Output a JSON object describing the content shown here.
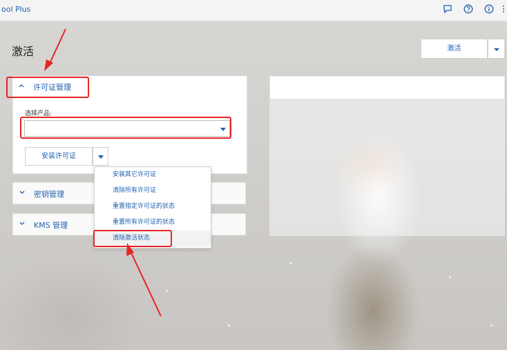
{
  "app": {
    "title": "ool Plus"
  },
  "topbar": {
    "icons": [
      "feedback-icon",
      "help-icon",
      "info-icon",
      "more-icon"
    ]
  },
  "page": {
    "title": "激活"
  },
  "activate_button": {
    "label": "激活"
  },
  "sections": [
    {
      "label": "许可证管理",
      "expanded": true
    },
    {
      "label": "密钥管理",
      "expanded": false
    },
    {
      "label": "KMS 管理",
      "expanded": false
    }
  ],
  "license": {
    "select_label": "选择产品:",
    "select_value": "",
    "install_button": "安装许可证"
  },
  "menu": {
    "items": [
      "安装其它许可证",
      "清除所有许可证",
      "重置指定许可证的状态",
      "重置所有许可证的状态",
      "清除激活状态"
    ],
    "highlighted_index": 4
  },
  "colors": {
    "accent": "#1f5fb0",
    "annotation": "#e52424"
  }
}
